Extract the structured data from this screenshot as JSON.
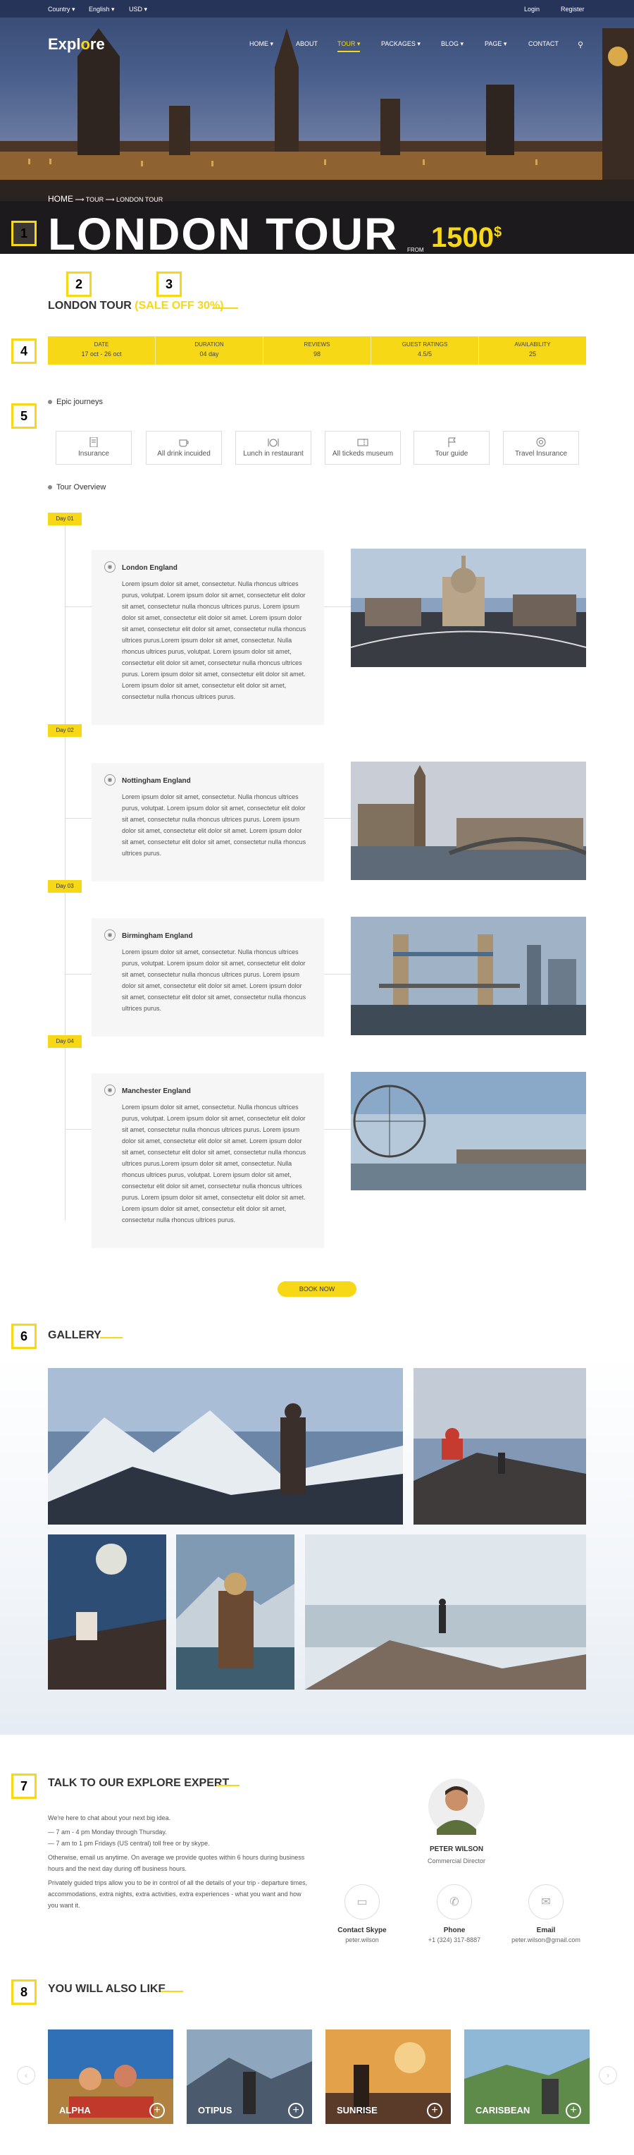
{
  "topbar": {
    "country": "Country",
    "language": "English",
    "currency": "USD",
    "login": "Login",
    "register": "Register"
  },
  "logo": {
    "text_a": "Expl",
    "text_o": "o",
    "text_b": "re"
  },
  "nav": {
    "home": "HOME",
    "about": "ABOUT",
    "tour": "TOUR",
    "packages": "PACKAGES",
    "blog": "BLOG",
    "page": "PAGE",
    "contact": "CONTACT"
  },
  "breadcrumb": {
    "home": "HOME",
    "tour": "TOUR",
    "current": "LONDON TOUR"
  },
  "hero": {
    "title": "LONDON TOUR",
    "from": "FROM",
    "price": "1500",
    "currency": "$"
  },
  "markers": [
    "1",
    "2",
    "3",
    "4",
    "5",
    "6",
    "7",
    "8"
  ],
  "tour": {
    "name": "LONDON TOUR",
    "sale": "(SALE OFF 30%)"
  },
  "info": [
    {
      "label": "DATE",
      "value": "17 oct - 26 oct"
    },
    {
      "label": "DURATION",
      "value": "04 day"
    },
    {
      "label": "REVIEWS",
      "value": "98"
    },
    {
      "label": "GUEST RATINGS",
      "value": "4.5/5"
    },
    {
      "label": "AVAILABILITY",
      "value": "25"
    }
  ],
  "epic": {
    "title": "Epic journeys",
    "items": [
      "Insurance",
      "All drink incuided",
      "Lunch in restaurant",
      "All tickeds museum",
      "Tour guide",
      "Travel Insurance"
    ]
  },
  "overview": {
    "title": "Tour Overview",
    "days": [
      {
        "badge": "Day 01",
        "title": "London England",
        "text": "Lorem ipsum dolor sit amet, consectetur. Nulla rhoncus ultrices purus, volutpat. Lorem ipsum dolor sit amet, consectetur elit dolor sit amet, consectetur nulla rhoncus ultrices purus. Lorem ipsum dolor sit amet, consectetur elit dolor sit amet. Lorem ipsum dolor sit amet, consectetur elit dolor sit amet, consectetur nulla rhoncus ultrices purus.Lorem ipsum dolor sit amet, consectetur. Nulla rhoncus ultrices purus, volutpat. Lorem ipsum dolor sit amet, consectetur elit dolor sit amet, consectetur nulla rhoncus ultrices purus. Lorem ipsum dolor sit amet, consectetur elit dolor sit amet. Lorem ipsum dolor sit amet, consectetur elit dolor sit amet, consectetur nulla rhoncus ultrices purus."
      },
      {
        "badge": "Day 02",
        "title": "Nottingham England",
        "text": "Lorem ipsum dolor sit amet, consectetur. Nulla rhoncus ultrices purus, volutpat. Lorem ipsum dolor sit amet, consectetur elit dolor sit amet, consectetur nulla rhoncus ultrices purus. Lorem ipsum dolor sit amet, consectetur elit dolor sit amet. Lorem ipsum dolor sit amet, consectetur elit dolor sit amet, consectetur nulla rhoncus ultrices purus."
      },
      {
        "badge": "Day 03",
        "title": "Birmingham England",
        "text": "Lorem ipsum dolor sit amet, consectetur. Nulla rhoncus ultrices purus, volutpat. Lorem ipsum dolor sit amet, consectetur elit dolor sit amet, consectetur nulla rhoncus ultrices purus. Lorem ipsum dolor sit amet, consectetur elit dolor sit amet. Lorem ipsum dolor sit amet, consectetur elit dolor sit amet, consectetur nulla rhoncus ultrices purus."
      },
      {
        "badge": "Day 04",
        "title": "Manchester England",
        "text": "Lorem ipsum dolor sit amet, consectetur. Nulla rhoncus ultrices purus, volutpat. Lorem ipsum dolor sit amet, consectetur elit dolor sit amet, consectetur nulla rhoncus ultrices purus. Lorem ipsum dolor sit amet, consectetur elit dolor sit amet. Lorem ipsum dolor sit amet, consectetur elit dolor sit amet, consectetur nulla rhoncus ultrices purus.Lorem ipsum dolor sit amet, consectetur. Nulla rhoncus ultrices purus, volutpat. Lorem ipsum dolor sit amet, consectetur elit dolor sit amet, consectetur nulla rhoncus ultrices purus. Lorem ipsum dolor sit amet, consectetur elit dolor sit amet. Lorem ipsum dolor sit amet, consectetur elit dolor sit amet, consectetur nulla rhoncus ultrices purus."
      }
    ]
  },
  "book_now": "BOOK NOW",
  "gallery": {
    "title": "GALLERY"
  },
  "expert": {
    "title": "TALK TO OUR EXPLORE EXPERT",
    "p1": "We're here to chat about your next big idea.",
    "p2": "— 7 am - 4 pm Monday through Thursday.",
    "p3": "— 7 am to 1 pm Fridays (US central) toll free or by skype.",
    "p4": "Otherwise, email us anytime. On average we provide quotes within 6 hours during business hours and the next day during off business hours.",
    "p5": "Privately guided trips allow you to be in control of all the details of your trip - departure times, accommodations, extra nights, extra activities, extra experiences - what you want and how you want it.",
    "name": "PETER WILSON",
    "role": "Commercial Director",
    "skype_label": "Contact Skype",
    "skype_value": "peter.wilson",
    "phone_label": "Phone",
    "phone_value": "+1 (324) 317-8887",
    "email_label": "Email",
    "email_value": "peter.wilson@gmail.com"
  },
  "also": {
    "title": "YOU WILL ALSO LIKE",
    "items": [
      "ALPHA",
      "OTIPUS",
      "SUNRISE",
      "CARISBEAN"
    ]
  },
  "colors": {
    "accent": "#f6d816"
  }
}
